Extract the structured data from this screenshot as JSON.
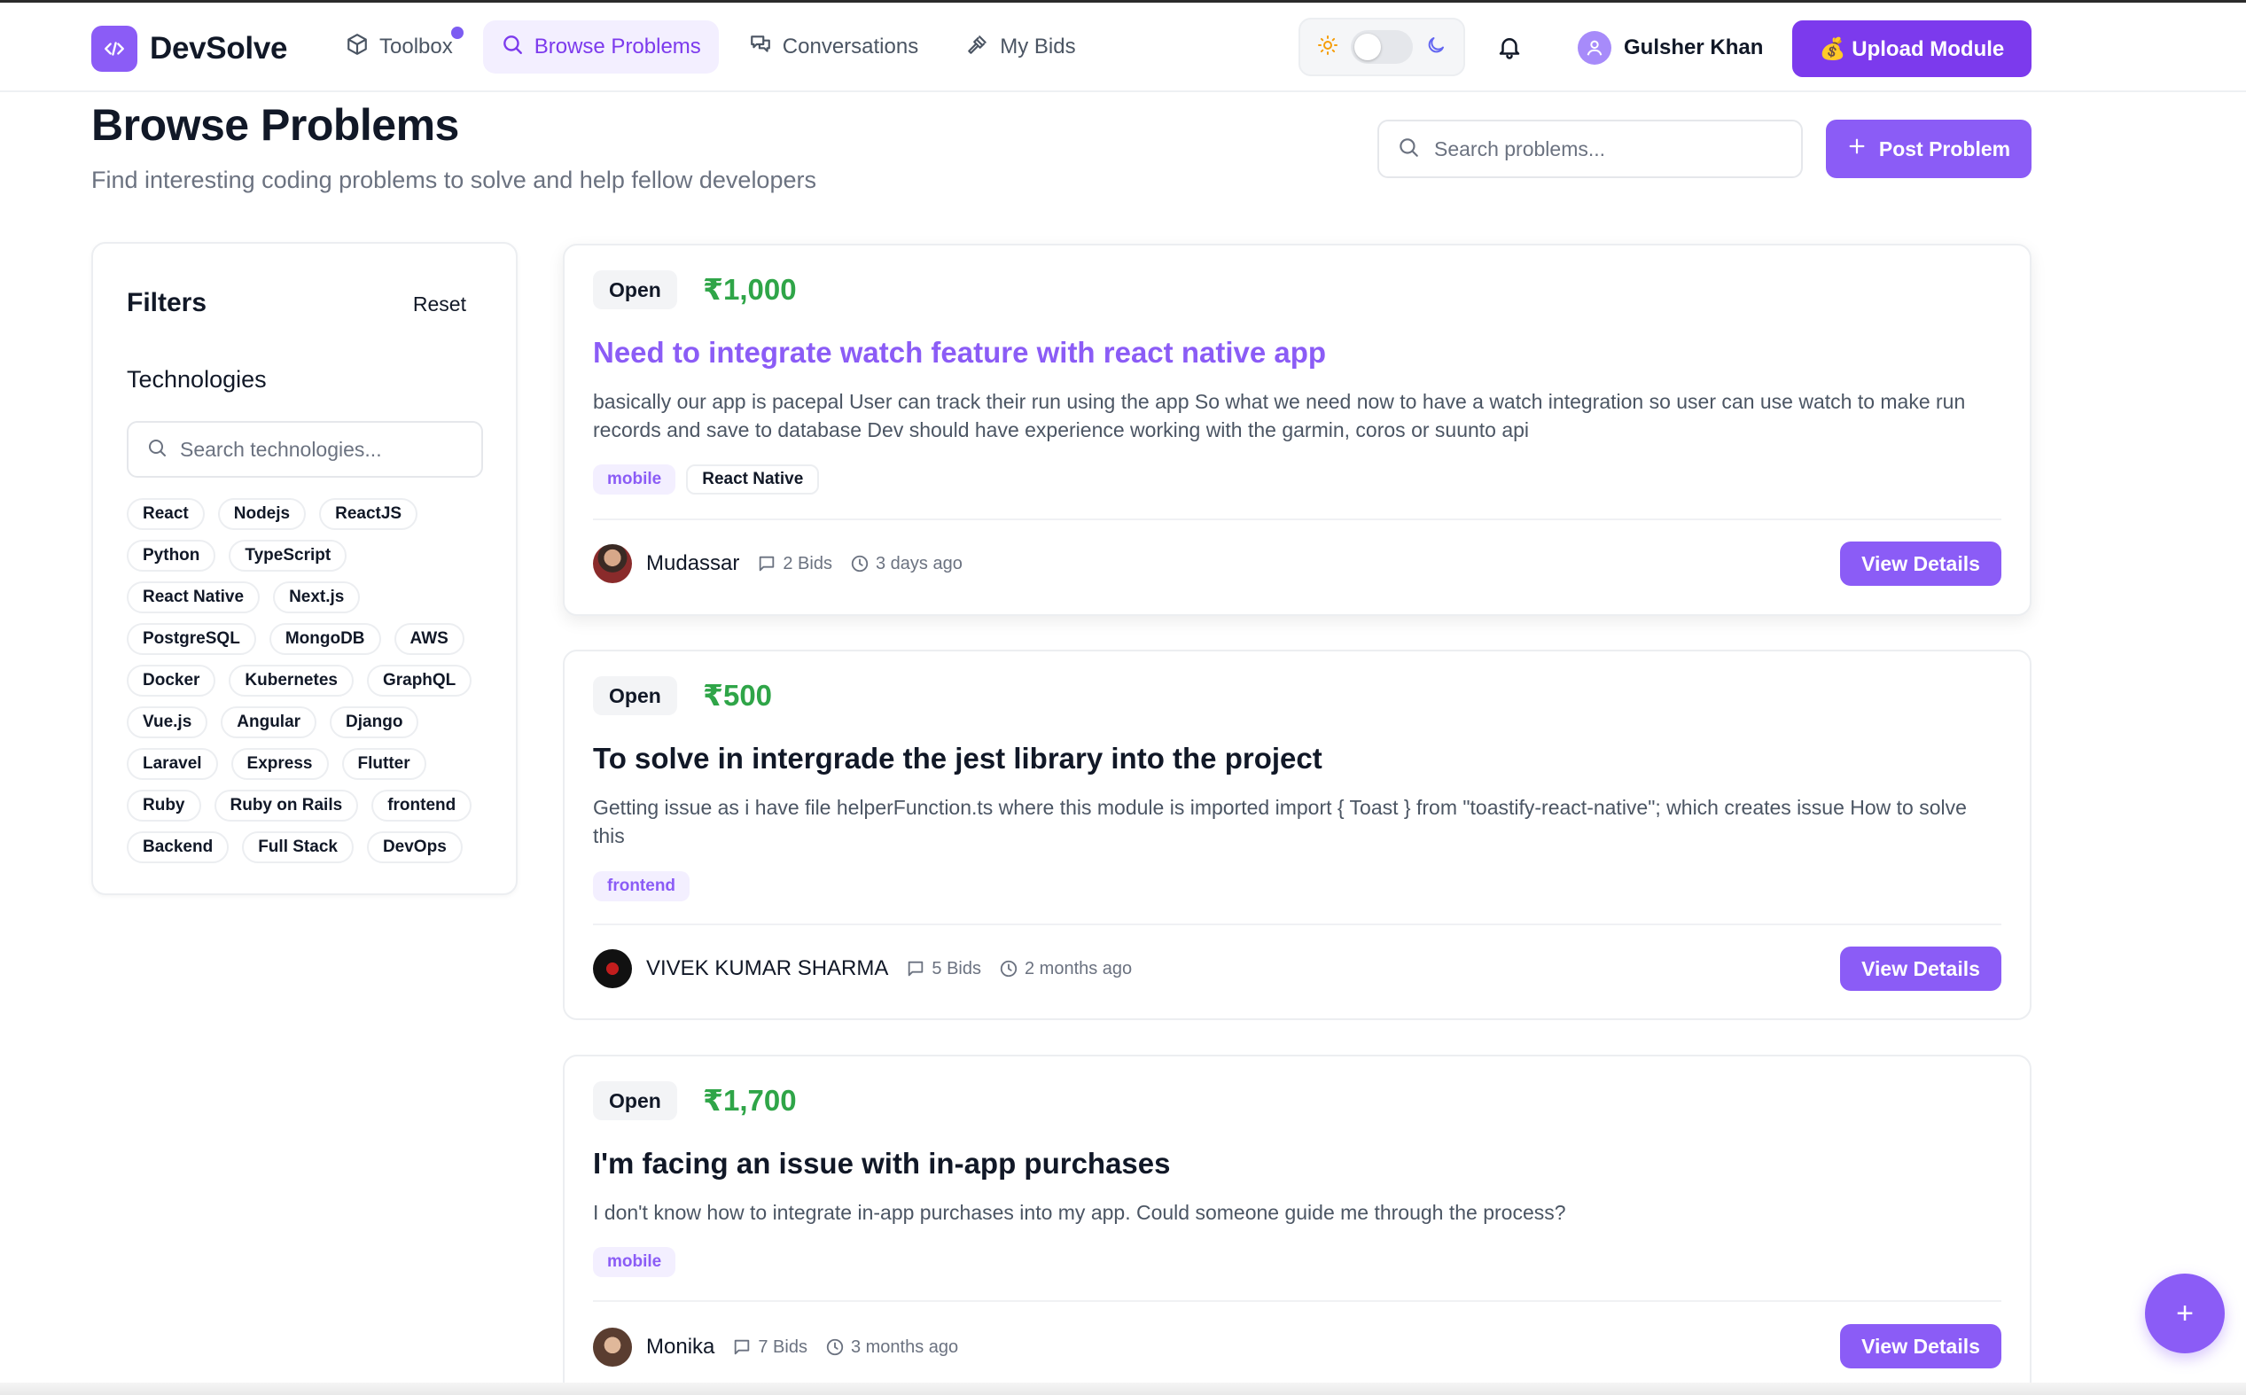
{
  "app": {
    "name": "DevSolve"
  },
  "nav": {
    "items": [
      {
        "label": "Toolbox",
        "icon": "box-icon",
        "active": false,
        "has_dot": true
      },
      {
        "label": "Browse Problems",
        "icon": "search-icon",
        "active": true
      },
      {
        "label": "Conversations",
        "icon": "chat-icon",
        "active": false
      },
      {
        "label": "My Bids",
        "icon": "gavel-icon",
        "active": false
      }
    ]
  },
  "header": {
    "user_name": "Gulsher Khan",
    "upload_label": "💰 Upload Module",
    "theme": "light"
  },
  "page": {
    "title": "Browse Problems",
    "subtitle": "Find interesting coding problems to solve and help fellow developers",
    "search_placeholder": "Search problems...",
    "post_label": "Post Problem"
  },
  "filters": {
    "title": "Filters",
    "reset_label": "Reset",
    "technologies_title": "Technologies",
    "tech_search_placeholder": "Search technologies...",
    "tags": [
      "React",
      "Nodejs",
      "ReactJS",
      "Python",
      "TypeScript",
      "React Native",
      "Next.js",
      "PostgreSQL",
      "MongoDB",
      "AWS",
      "Docker",
      "Kubernetes",
      "GraphQL",
      "Vue.js",
      "Angular",
      "Django",
      "Laravel",
      "Express",
      "Flutter",
      "Ruby",
      "Ruby on Rails",
      "frontend",
      "Backend",
      "Full Stack",
      "DevOps"
    ]
  },
  "problems": [
    {
      "status": "Open",
      "price": "₹1,000",
      "title": "Need to integrate watch feature with react native app",
      "description": "basically our app is pacepal User can track their run using the app So what we need now to have a watch integration so user can use watch to make run records and save to database Dev should have experience working with the garmin, coros or suunto api",
      "tags": [
        {
          "label": "mobile",
          "style": "purple"
        },
        {
          "label": "React Native",
          "style": "plain"
        }
      ],
      "author": "Mudassar",
      "bids": "2 Bids",
      "time": "3 days ago",
      "button": "View Details"
    },
    {
      "status": "Open",
      "price": "₹500",
      "title": "To solve in intergrade the jest library into the project",
      "description": "Getting issue as i have file helperFunction.ts where this module is imported import { Toast } from \"toastify-react-native\"; which creates issue How to solve this",
      "tags": [
        {
          "label": "frontend",
          "style": "purple"
        }
      ],
      "author": "VIVEK KUMAR SHARMA",
      "bids": "5 Bids",
      "time": "2 months ago",
      "button": "View Details"
    },
    {
      "status": "Open",
      "price": "₹1,700",
      "title": "I'm facing an issue with in-app purchases",
      "description": "I don't know how to integrate in-app purchases into my app. Could someone guide me through the process?",
      "tags": [
        {
          "label": "mobile",
          "style": "purple"
        }
      ],
      "author": "Monika",
      "bids": "7 Bids",
      "time": "3 months ago",
      "button": "View Details"
    }
  ],
  "fab_label": "+",
  "colors": {
    "accent": "#8b5cf6",
    "accent_dark": "#7c3aed",
    "price": "#2fa548"
  }
}
